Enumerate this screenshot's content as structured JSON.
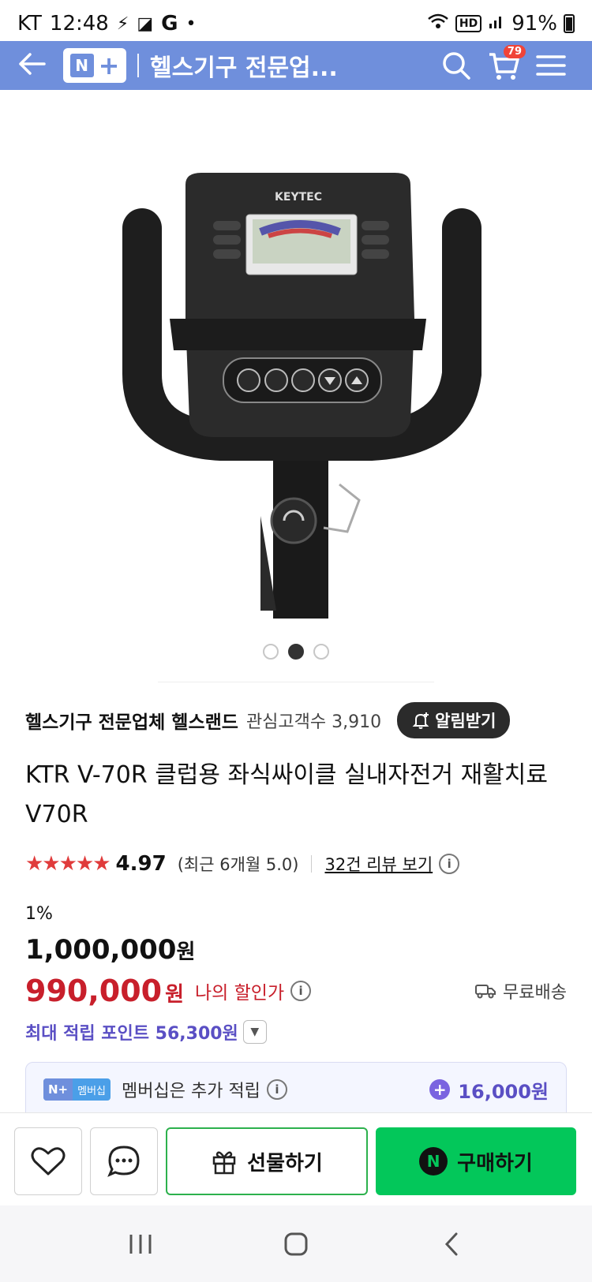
{
  "status": {
    "carrier": "KT",
    "time": "12:48",
    "extra_icons": [
      "bolt-icon",
      "naver-band-icon",
      "google-icon",
      "dot-icon"
    ],
    "hd": "HD",
    "battery": "91%"
  },
  "header": {
    "back_icon": "back-arrow-icon",
    "badge_n": "N",
    "badge_plus": "+",
    "title": "헬스기구 전문업...",
    "cart_count": "79"
  },
  "gallery": {
    "total": 3,
    "active_index": 1
  },
  "seller": {
    "name": "헬스기구 전문업체 헬스랜드",
    "fav_label": "관심고객수",
    "fav_count": "3,910",
    "notify_label": "알림받기"
  },
  "product": {
    "title": "KTR V-70R 클럽용 좌식싸이클 실내자전거 재활치료 V70R"
  },
  "rating": {
    "stars": "★★★★★",
    "score": "4.97",
    "recent": "(최근 6개월 5.0)",
    "review_link": "32건 리뷰 보기"
  },
  "price": {
    "discount": "1%",
    "original": "1,000,000",
    "original_unit": "원",
    "sale": "990,000",
    "sale_unit": "원",
    "my_discount_label": "나의 할인가",
    "shipping": "무료배송",
    "points_label": "최대 적립 포인트 56,300원"
  },
  "membership": {
    "badge_np": "N+",
    "badge_label": "멤버십",
    "text": "멤버십은 추가 적립",
    "points": "16,000원"
  },
  "actions": {
    "gift_label": "선물하기",
    "buy_label": "구매하기",
    "buy_badge": "N"
  },
  "colors": {
    "header_bg": "#6f8fdc",
    "sale_red": "#c81f2b",
    "points_purple": "#5a4fc4",
    "buy_green": "#03c75a"
  }
}
